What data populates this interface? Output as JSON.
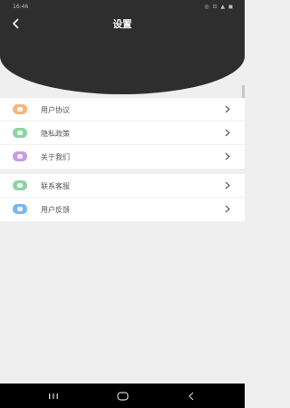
{
  "status_bar": {
    "time": "16:46",
    "icons": "◎ ⊡ ▲ ◼"
  },
  "header": {
    "title": "设置"
  },
  "groups": [
    {
      "items": [
        {
          "label": "用户协议",
          "icon": "agreement-icon",
          "color": "#f5b87a"
        },
        {
          "label": "隐私政策",
          "icon": "privacy-icon",
          "color": "#8fd3a3"
        },
        {
          "label": "关于我们",
          "icon": "about-icon",
          "color": "#c89be3"
        }
      ]
    },
    {
      "items": [
        {
          "label": "联系客服",
          "icon": "customer-service-icon",
          "color": "#8fd3a3"
        },
        {
          "label": "用户反馈",
          "icon": "feedback-icon",
          "color": "#79b7ee"
        }
      ]
    }
  ],
  "nav": {
    "recent": "recents-icon",
    "home": "home-icon",
    "back": "back-icon"
  }
}
